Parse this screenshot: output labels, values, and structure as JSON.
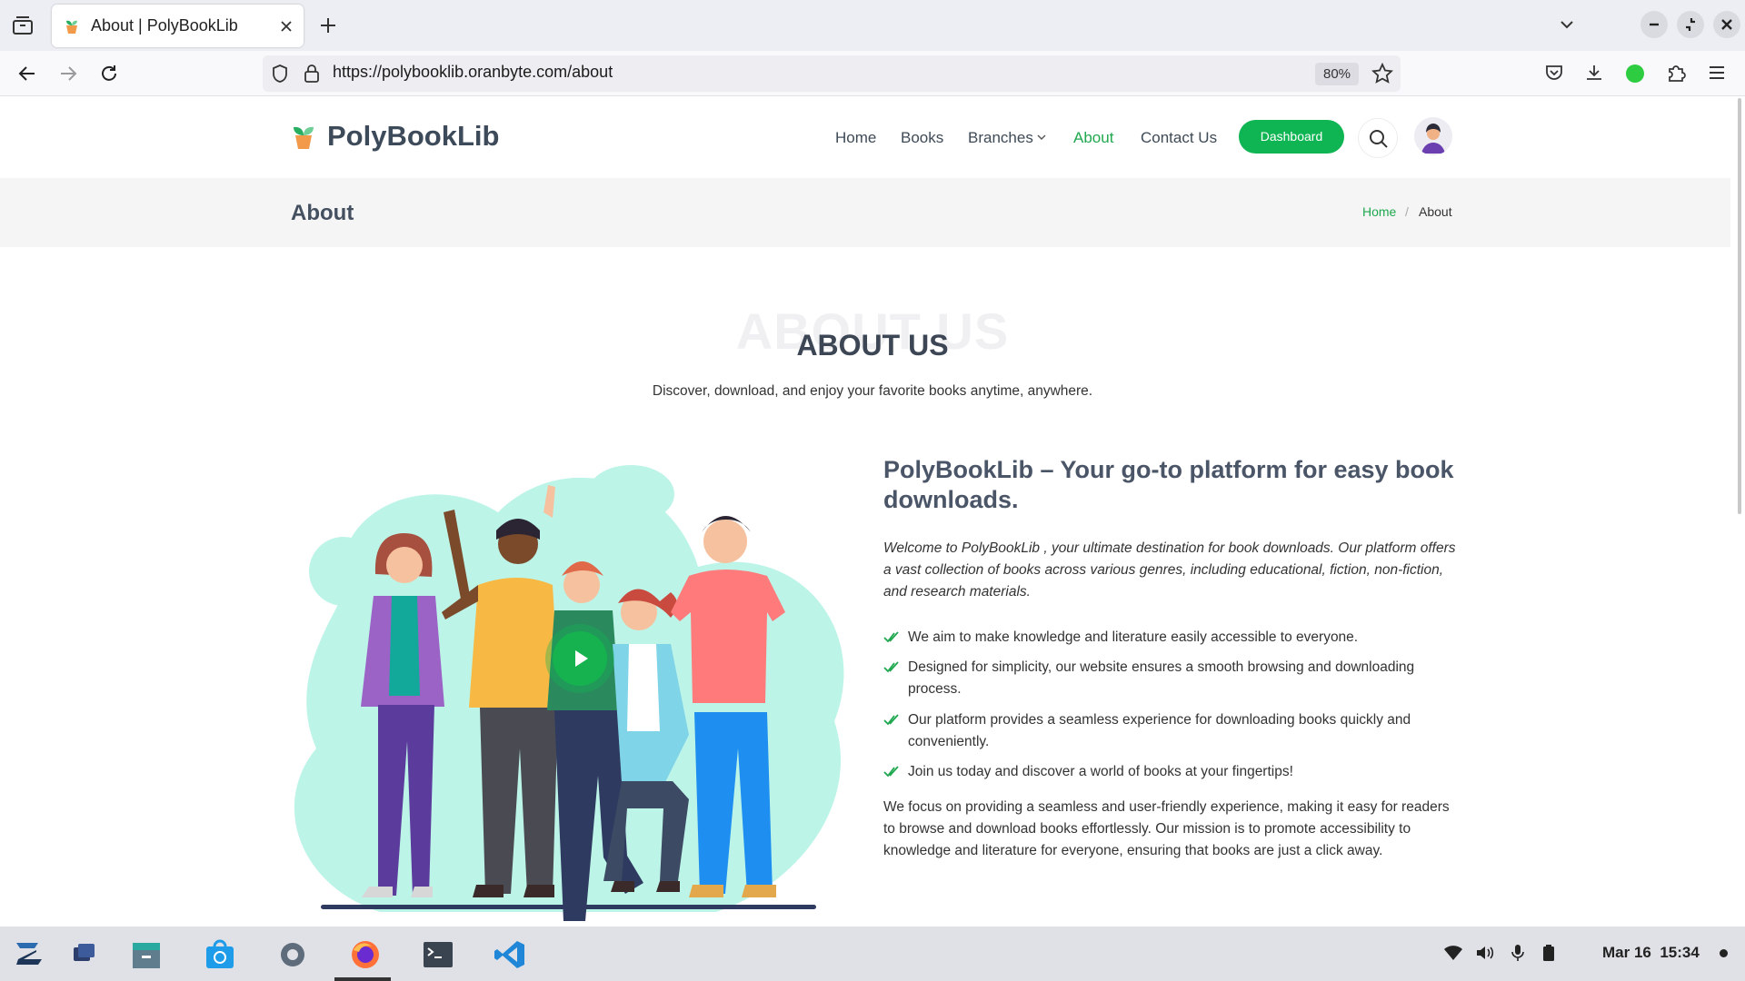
{
  "browser": {
    "tab_title": "About | PolyBookLib",
    "url": "https://polybooklib.oranbyte.com/about",
    "zoom": "80%"
  },
  "site": {
    "brand": "PolyBookLib",
    "nav": {
      "home": "Home",
      "books": "Books",
      "branches": "Branches",
      "about": "About",
      "contact": "Contact Us",
      "dashboard": "Dashboard"
    }
  },
  "page": {
    "title": "About",
    "breadcrumb": {
      "home": "Home",
      "separator": "/",
      "current": "About"
    }
  },
  "section": {
    "bg_title": "ABOUT US",
    "title": "ABOUT US",
    "subtitle": "Discover, download, and enjoy your favorite books anytime, anywhere."
  },
  "content": {
    "heading": "PolyBookLib – Your go-to platform for easy book downloads.",
    "intro": "Welcome to PolyBookLib , your ultimate destination for book downloads. Our platform offers a vast collection of books across various genres, including educational, fiction, non-fiction, and research materials.",
    "points": [
      "We aim to make knowledge and literature easily accessible to everyone.",
      "Designed for simplicity, our website ensures a smooth browsing and downloading process.",
      "Our platform provides a seamless experience for downloading books quickly and conveniently.",
      "Join us today and discover a world of books at your fingertips!"
    ],
    "paragraph": "We focus on providing a seamless and user-friendly experience, making it easy for readers to browse and download books effortlessly. Our mission is to promote accessibility to knowledge and literature for everyone, ensuring that books are just a click away."
  },
  "taskbar": {
    "date": "Mar 16",
    "time": "15:34"
  },
  "colors": {
    "accent": "#0fb552",
    "heading": "#3d4654",
    "blob": "#bdf4e8"
  }
}
